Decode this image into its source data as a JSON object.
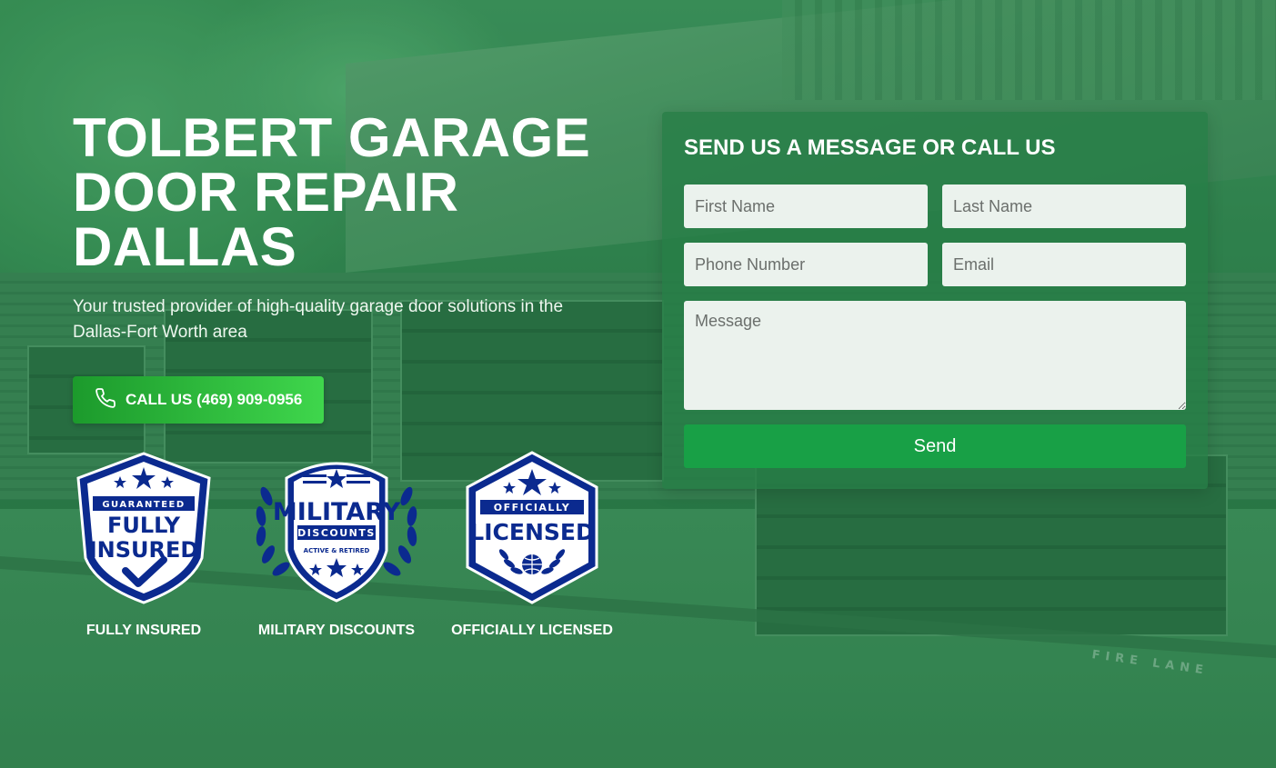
{
  "hero": {
    "title": "TOLBERT GARAGE DOOR REPAIR DALLAS",
    "subtitle": "Your trusted provider of high-quality garage door solutions in the Dallas-Fort Worth area",
    "call_button_label": "CALL US (469) 909-0956",
    "call_icon": "phone-icon",
    "background_text": "FIRE LANE"
  },
  "badges": [
    {
      "label": "FULLY INSURED",
      "art_lines": [
        "GUARANTEED",
        "FULLY",
        "INSURED"
      ],
      "icon": "shield-check-icon"
    },
    {
      "label": "MILITARY DISCOUNTS",
      "art_lines": [
        "MILITARY",
        "DISCOUNTS",
        "ACTIVE & RETIRED"
      ],
      "icon": "laurel-shield-icon"
    },
    {
      "label": "OFFICIALLY LICENSED",
      "art_lines": [
        "OFFICIALLY",
        "LICENSED"
      ],
      "icon": "globe-hexagon-icon"
    }
  ],
  "contact_form": {
    "title": "SEND US A MESSAGE OR CALL US",
    "first_name_placeholder": "First Name",
    "last_name_placeholder": "Last Name",
    "phone_placeholder": "Phone Number",
    "email_placeholder": "Email",
    "message_placeholder": "Message",
    "send_label": "Send"
  },
  "colors": {
    "overlay_green": "#2f7d4c",
    "call_button_start": "#1c9a2c",
    "call_button_end": "#3fd64c",
    "send_button": "#18a046",
    "badge_navy": "#0b2a8f",
    "field_bg": "#ebf2ed"
  }
}
